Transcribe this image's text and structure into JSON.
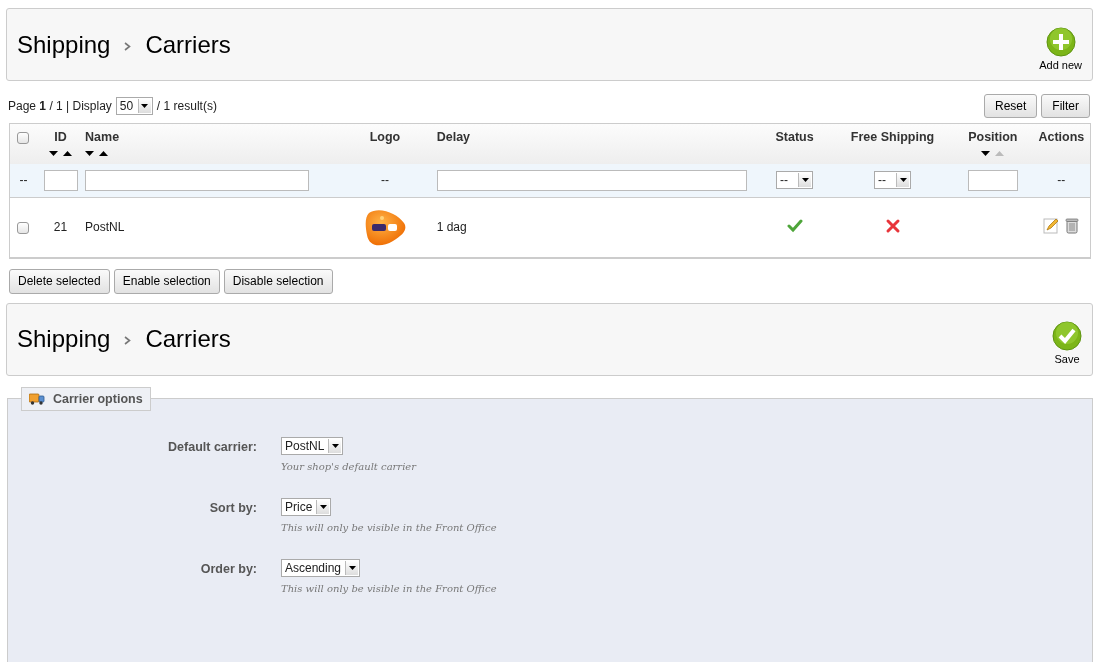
{
  "list_header": {
    "breadcrumb": [
      "Shipping",
      "Carriers"
    ],
    "action": {
      "kind": "add",
      "label": "Add new"
    }
  },
  "pagination": {
    "summary": "Page **1** / 1 | Display",
    "per_page": "50",
    "results": "/ 1 result(s)"
  },
  "filter_buttons": [
    "Reset",
    "Filter"
  ],
  "table": {
    "select_all": {
      "checked": false
    },
    "columns": [
      {
        "label": "ID",
        "sort_arrows": {
          "down_active": true,
          "up_active": true
        }
      },
      {
        "label": "Name",
        "sort_arrows": {
          "down_active": true,
          "up_active": true
        }
      },
      {
        "label": "Logo"
      },
      {
        "label": "Delay"
      },
      {
        "label": "Status"
      },
      {
        "label": "Free Shipping"
      },
      {
        "label": "Position",
        "sort_arrows": {
          "down_active": true,
          "up_active": false
        }
      },
      {
        "label": "Actions"
      }
    ],
    "filters": [
      {
        "kind": "text",
        "text": "--"
      },
      {
        "kind": "input"
      },
      {
        "kind": "input"
      },
      {
        "kind": "text",
        "text": "--"
      },
      {
        "kind": "input"
      },
      {
        "kind": "select",
        "value": "--"
      },
      {
        "kind": "select",
        "value": "--"
      },
      {
        "kind": "input"
      },
      {
        "kind": "text",
        "text": "--"
      }
    ],
    "rows": [
      {
        "checked": false,
        "id": "21",
        "name": "PostNL",
        "delay": "1 dag",
        "status": true,
        "free_shipping": false,
        "actions": {
          "edit": true,
          "delete": true
        }
      }
    ]
  },
  "bulk_buttons": [
    "Delete selected",
    "Enable selection",
    "Disable selection"
  ],
  "options_header": {
    "breadcrumb": [
      "Shipping",
      "Carriers"
    ],
    "action": {
      "kind": "save",
      "label": "Save"
    }
  },
  "carrier_options": {
    "legend": "Carrier options",
    "fields": [
      {
        "label": "Default carrier:",
        "value": "PostNL",
        "hint": "Your shop's default carrier"
      },
      {
        "label": "Sort by:",
        "value": "Price",
        "hint": "This will only be visible in the Front Office"
      },
      {
        "label": "Order by:",
        "value": "Ascending",
        "hint": "This will only be visible in the Front Office"
      }
    ]
  }
}
